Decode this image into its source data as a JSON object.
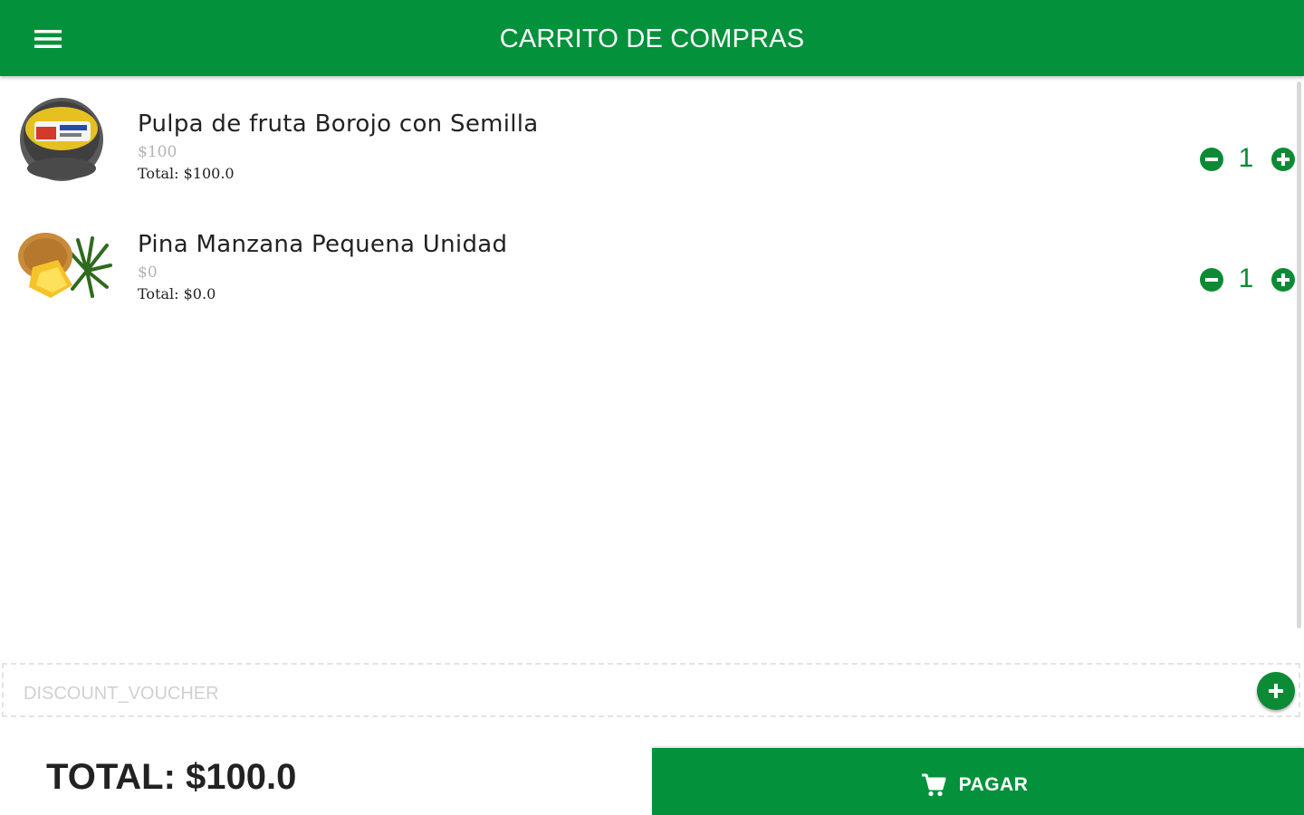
{
  "header": {
    "title": "CARRITO DE COMPRAS",
    "menu_icon": "hamburger-menu-icon"
  },
  "cart": {
    "items": [
      {
        "name": "Pulpa de fruta Borojo con Semilla",
        "unit_price": "$100",
        "total": "Total: $100.0",
        "quantity": "1",
        "image": "fruit-pulp-package"
      },
      {
        "name": "Pina Manzana Pequena Unidad",
        "unit_price": "$0",
        "total": "Total: $0.0",
        "quantity": "1",
        "image": "pineapple"
      }
    ]
  },
  "voucher": {
    "placeholder": "DISCOUNT_VOUCHER",
    "add_icon": "plus-circle-icon"
  },
  "footer": {
    "total_label": "TOTAL: $100.0",
    "pay_label": "PAGAR",
    "pay_icon": "shopping-cart-icon"
  },
  "colors": {
    "primary": "#03913b",
    "accent": "#0d8a36",
    "text": "#222222",
    "muted": "#b3b3b3"
  }
}
